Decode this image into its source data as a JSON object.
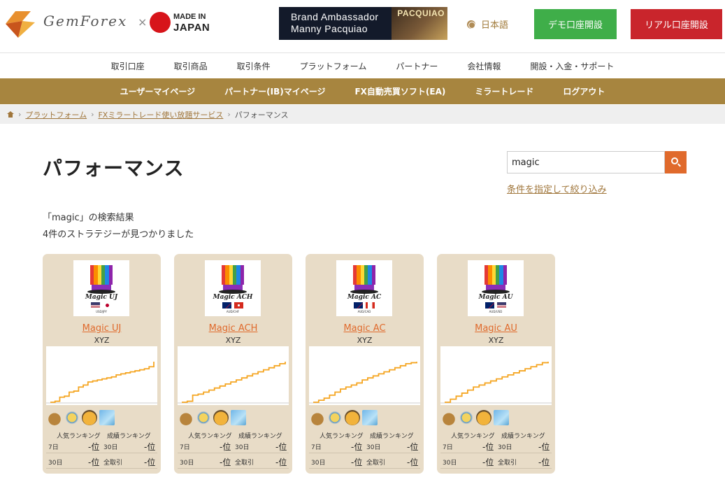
{
  "header": {
    "logo_text": "GemForex",
    "logo_x": "×",
    "made_in_line1": "MADE IN",
    "made_in_line2": "JAPAN",
    "ambassador_line1": "Brand Ambassador",
    "ambassador_line2": "Manny Pacquiao",
    "ambassador_photo_name": "PACQUIAO",
    "language": "日本語",
    "demo_button": "デモ口座開設",
    "real_button": "リアル口座開設"
  },
  "main_nav": [
    "取引口座",
    "取引商品",
    "取引条件",
    "プラットフォーム",
    "パートナー",
    "会社情報",
    "開設・入金・サポート"
  ],
  "sub_nav": [
    "ユーザーマイページ",
    "パートナー(IB)マイページ",
    "FX自動売買ソフト(EA)",
    "ミラートレード",
    "ログアウト"
  ],
  "breadcrumb": {
    "items": [
      "プラットフォーム",
      "FXミラートレード使い放題サービス"
    ],
    "current": "パフォーマンス",
    "separator": "›"
  },
  "page": {
    "title": "パフォーマンス",
    "search_value": "magic",
    "filter_link": "条件を指定して絞り込み",
    "result_query_line": "「magic」の検索結果",
    "result_count_line": "4件のストラテジーが見つかりました"
  },
  "cards": [
    {
      "name": "Magic UJ",
      "thumb_name": "Magic UJ",
      "author": "XYZ",
      "pair": "USD/JPY",
      "flags": [
        "us",
        "jp"
      ],
      "rank_popular_label": "人気ランキング",
      "rank_result_label": "成績ランキング",
      "r1_left_label": "7日",
      "r1_left_value": "-位",
      "r1_right_label": "30日",
      "r1_right_value": "-位",
      "r2_left_label": "30日",
      "r2_left_value": "-位",
      "r2_right_label": "全取引",
      "r2_right_value": "-位",
      "equity_curve": [
        0,
        2,
        10,
        12,
        20,
        22,
        30,
        34,
        40,
        42,
        44,
        46,
        48,
        50,
        54,
        56,
        58,
        60,
        62,
        64,
        66,
        70,
        80
      ]
    },
    {
      "name": "Magic ACH",
      "thumb_name": "Magic ACH",
      "author": "XYZ",
      "pair": "AUD/CHF",
      "flags": [
        "au",
        "ch"
      ],
      "rank_popular_label": "人気ランキング",
      "rank_result_label": "成績ランキング",
      "r1_left_label": "7日",
      "r1_left_value": "-位",
      "r1_right_label": "30日",
      "r1_right_value": "-位",
      "r2_left_label": "30日",
      "r2_left_value": "-位",
      "r2_right_label": "全取引",
      "r2_right_value": "-位",
      "equity_curve": [
        0,
        2,
        14,
        16,
        20,
        24,
        28,
        32,
        36,
        40,
        44,
        48,
        52,
        56,
        60,
        64,
        68,
        72,
        76,
        80
      ]
    },
    {
      "name": "Magic AC",
      "thumb_name": "Magic AC",
      "author": "XYZ",
      "pair": "AUD/CAD",
      "flags": [
        "au",
        "ca"
      ],
      "rank_popular_label": "人気ランキング",
      "rank_result_label": "成績ランキング",
      "r1_left_label": "7日",
      "r1_left_value": "-位",
      "r1_right_label": "30日",
      "r1_right_value": "-位",
      "r2_left_label": "30日",
      "r2_left_value": "-位",
      "r2_right_label": "全取引",
      "r2_right_value": "-位",
      "equity_curve": [
        0,
        4,
        8,
        14,
        20,
        26,
        30,
        34,
        38,
        44,
        48,
        52,
        56,
        60,
        64,
        68,
        72,
        76,
        78,
        80
      ]
    },
    {
      "name": "Magic AU",
      "thumb_name": "Magic AU",
      "author": "XYZ",
      "pair": "AUD/USD",
      "flags": [
        "au",
        "us"
      ],
      "rank_popular_label": "人気ランキング",
      "rank_result_label": "成績ランキング",
      "r1_left_label": "7日",
      "r1_left_value": "-位",
      "r1_right_label": "30日",
      "r1_right_value": "-位",
      "r2_left_label": "30日",
      "r2_left_value": "-位",
      "r2_right_label": "全取引",
      "r2_right_value": "-位",
      "equity_curve": [
        0,
        6,
        12,
        18,
        24,
        30,
        34,
        38,
        42,
        46,
        50,
        54,
        58,
        62,
        66,
        70,
        74,
        78,
        80
      ]
    }
  ],
  "colors": {
    "brand_gold": "#a7853f",
    "demo_green": "#3fae49",
    "real_red": "#c9252c",
    "accent_orange": "#e06a2c",
    "card_bg": "#e8dcc7",
    "curve": "#f5a623"
  },
  "icons": [
    "gem-logo-icon",
    "globe-icon",
    "home-icon",
    "search-icon",
    "money-bag-icon",
    "sun-badge-icon",
    "chat-badge-icon",
    "chart-box-icon"
  ]
}
